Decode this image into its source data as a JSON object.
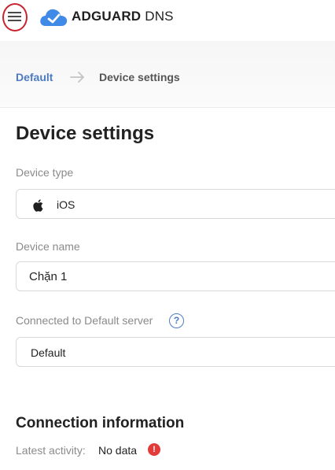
{
  "header": {
    "logo_bold": "ADGUARD",
    "logo_thin": " DNS",
    "menu_icon": "hamburger-icon",
    "brand_color": "#3f8ae6",
    "highlight_color": "#c8242f"
  },
  "breadcrumb": {
    "parent": "Default",
    "current": "Device settings"
  },
  "page": {
    "title": "Device settings"
  },
  "form": {
    "device_type": {
      "label": "Device type",
      "value": "iOS",
      "icon": "apple-icon"
    },
    "device_name": {
      "label": "Device name",
      "value": "Chặn 1"
    },
    "server": {
      "label": "Connected to Default server",
      "value": "Default",
      "help_icon": "question-icon"
    }
  },
  "connection": {
    "title": "Connection information",
    "latest_activity_label": "Latest activity:",
    "latest_activity_value": "No data",
    "warning_icon": "error-icon",
    "warning_color": "#e33a3a"
  },
  "symbols": {
    "help": "?",
    "warning": "!"
  }
}
